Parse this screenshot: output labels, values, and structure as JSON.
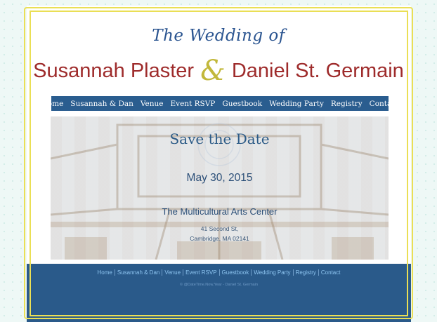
{
  "header": {
    "subtitle": "The Wedding of",
    "name_left": "Susannah Plaster",
    "ampersand": "&",
    "name_right": "Daniel St. Germain"
  },
  "nav": {
    "items": [
      {
        "label": "Home"
      },
      {
        "label": "Susannah & Dan"
      },
      {
        "label": "Venue"
      },
      {
        "label": "Event RSVP"
      },
      {
        "label": "Guestbook"
      },
      {
        "label": "Wedding Party"
      },
      {
        "label": "Registry"
      },
      {
        "label": "Contact"
      }
    ]
  },
  "hero": {
    "title": "Save the Date",
    "date": "May 30, 2015",
    "venue": "The Multicultural Arts Center",
    "address_line1": "41 Second St,",
    "address_line2": "Cambridge, MA 02141"
  },
  "footer": {
    "links": [
      {
        "label": "Home"
      },
      {
        "label": "Susannah & Dan"
      },
      {
        "label": "Venue"
      },
      {
        "label": "Event RSVP"
      },
      {
        "label": "Guestbook"
      },
      {
        "label": "Wedding Party"
      },
      {
        "label": "Registry"
      },
      {
        "label": "Contact"
      }
    ],
    "copyright": "© @DateTime.Now.Year - Daniel St. Germain"
  },
  "colors": {
    "page_background": "#eef8f6",
    "frame": "#eadf55",
    "nav_background": "#2a5d8f",
    "name_color": "#9e2b2b",
    "ampersand_color": "#c2b83b",
    "title_blue": "#2a5490",
    "footer_background": "#2a5a8a",
    "footer_link": "#8cc3ef"
  }
}
